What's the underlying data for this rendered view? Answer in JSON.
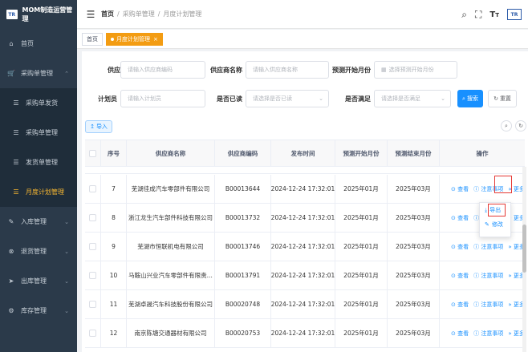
{
  "app": {
    "title": "MOM制造运营管理",
    "logo_text": "TR"
  },
  "sidebar": {
    "items": [
      {
        "label": "首页",
        "icon": "home-icon"
      },
      {
        "label": "采购单管理",
        "icon": "cart-icon",
        "expanded": true
      },
      {
        "label": "采购单发货",
        "icon": "list-icon",
        "sub": true
      },
      {
        "label": "采购单管理",
        "icon": "list-icon",
        "sub": true
      },
      {
        "label": "发货单管理",
        "icon": "list-icon",
        "sub": true
      },
      {
        "label": "月度计划管理",
        "icon": "list-icon",
        "sub": true,
        "active": true
      },
      {
        "label": "入库管理",
        "icon": "edit-icon"
      },
      {
        "label": "退货管理",
        "icon": "return-icon"
      },
      {
        "label": "出库管理",
        "icon": "send-icon"
      },
      {
        "label": "库存管理",
        "icon": "gear-icon"
      }
    ]
  },
  "header": {
    "breadcrumb": [
      "首页",
      "采购单管理",
      "月度计划管理"
    ],
    "brand_logo_text": "TR"
  },
  "tabs": [
    {
      "label": "首页",
      "active": false
    },
    {
      "label": "月度计划管理",
      "active": true
    }
  ],
  "filters": {
    "supplier_code": {
      "label": "供应商编码",
      "placeholder": "请输入供应商编码"
    },
    "supplier_name": {
      "label": "供应商名称",
      "placeholder": "请输入供应商名称"
    },
    "forecast_start_month": {
      "label": "预测开始月份",
      "placeholder": "选择预测开始月份"
    },
    "planner": {
      "label": "计划员",
      "placeholder": "请输入计划员"
    },
    "is_read": {
      "label": "是否已读",
      "placeholder": "请选择是否已读"
    },
    "is_satisfied": {
      "label": "是否满足",
      "placeholder": "请选择是否满足"
    },
    "search_button": "搜索",
    "reset_button": "重置"
  },
  "toolbar": {
    "import_label": "导入"
  },
  "table": {
    "columns": [
      "序号",
      "供应商名称",
      "供应商编码",
      "发布时间",
      "预测开始月份",
      "预测结束月份",
      "操作"
    ],
    "rows": [
      {
        "no": "7",
        "name": "芜湖佳成汽车零部件有限公司",
        "code": "B00013644",
        "time": "2024-12-24 17:32:01",
        "start": "2025年01月",
        "end": "2025年03月"
      },
      {
        "no": "8",
        "name": "浙江龙生汽车部件科技有限公司",
        "code": "B00013732",
        "time": "2024-12-24 17:32:01",
        "start": "2025年01月",
        "end": "2025年03月"
      },
      {
        "no": "9",
        "name": "芜湖市恒联机电有限公司",
        "code": "B00013746",
        "time": "2024-12-24 17:32:01",
        "start": "2025年01月",
        "end": "2025年03月"
      },
      {
        "no": "10",
        "name": "马鞍山兴业汽车零部件有限责...",
        "code": "B00013791",
        "time": "2024-12-24 17:32:01",
        "start": "2025年01月",
        "end": "2025年03月"
      },
      {
        "no": "11",
        "name": "芜湖卓晟汽车科技股份有限公司",
        "code": "B00020748",
        "time": "2024-12-24 17:32:01",
        "start": "2025年01月",
        "end": "2025年03月"
      },
      {
        "no": "12",
        "name": "南京陈塘交通器材有限公司",
        "code": "B00020753",
        "time": "2024-12-24 17:32:01",
        "start": "2025年01月",
        "end": "2025年03月"
      }
    ],
    "actions": {
      "view": "查看",
      "notes": "注意事项",
      "more": "更多"
    }
  },
  "more_menu": {
    "export": "导出",
    "edit": "修改"
  },
  "colors": {
    "sidebar": "#2b3a4a",
    "accent": "#f39c12",
    "primary": "#1890ff",
    "highlight": "#e53935"
  }
}
